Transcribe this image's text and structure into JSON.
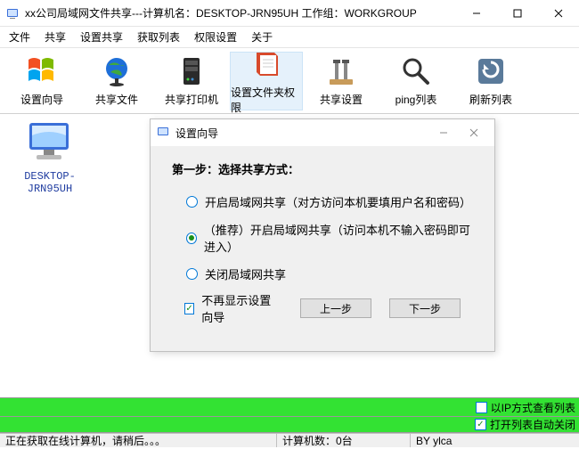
{
  "window": {
    "title": "xx公司局域网文件共享---计算机名：DESKTOP-JRN95UH  工作组：WORKGROUP"
  },
  "menu": {
    "file": "文件",
    "share": "共享",
    "set_share": "设置共享",
    "get_list": "获取列表",
    "perm": "权限设置",
    "about": "关于"
  },
  "toolbar": {
    "wizard": "设置向导",
    "share_file": "共享文件",
    "share_printer": "共享打印机",
    "folder_perm": "设置文件夹权限",
    "share_settings": "共享设置",
    "ping_list": "ping列表",
    "refresh": "刷新列表"
  },
  "computer": {
    "name": "DESKTOP-JRN95UH"
  },
  "wizard": {
    "title": "设置向导",
    "step_title": "第一步：选择共享方式：",
    "opt1": "开启局域网共享（对方访问本机要填用户名和密码）",
    "opt2": "（推荐）开启局域网共享（访问本机不输入密码即可进入）",
    "opt3": "关闭局域网共享",
    "selected": 2,
    "dont_show": "不再显示设置向导",
    "dont_show_checked": true,
    "prev": "上一步",
    "next": "下一步"
  },
  "options_bar": {
    "ip_view": "以IP方式查看列表",
    "ip_view_checked": false,
    "auto_close": "打开列表自动关闭",
    "auto_close_checked": true
  },
  "status": {
    "left": "正在获取在线计算机，请稍后。。。",
    "mid": "计算机数：0台",
    "right": "BY ylca"
  }
}
